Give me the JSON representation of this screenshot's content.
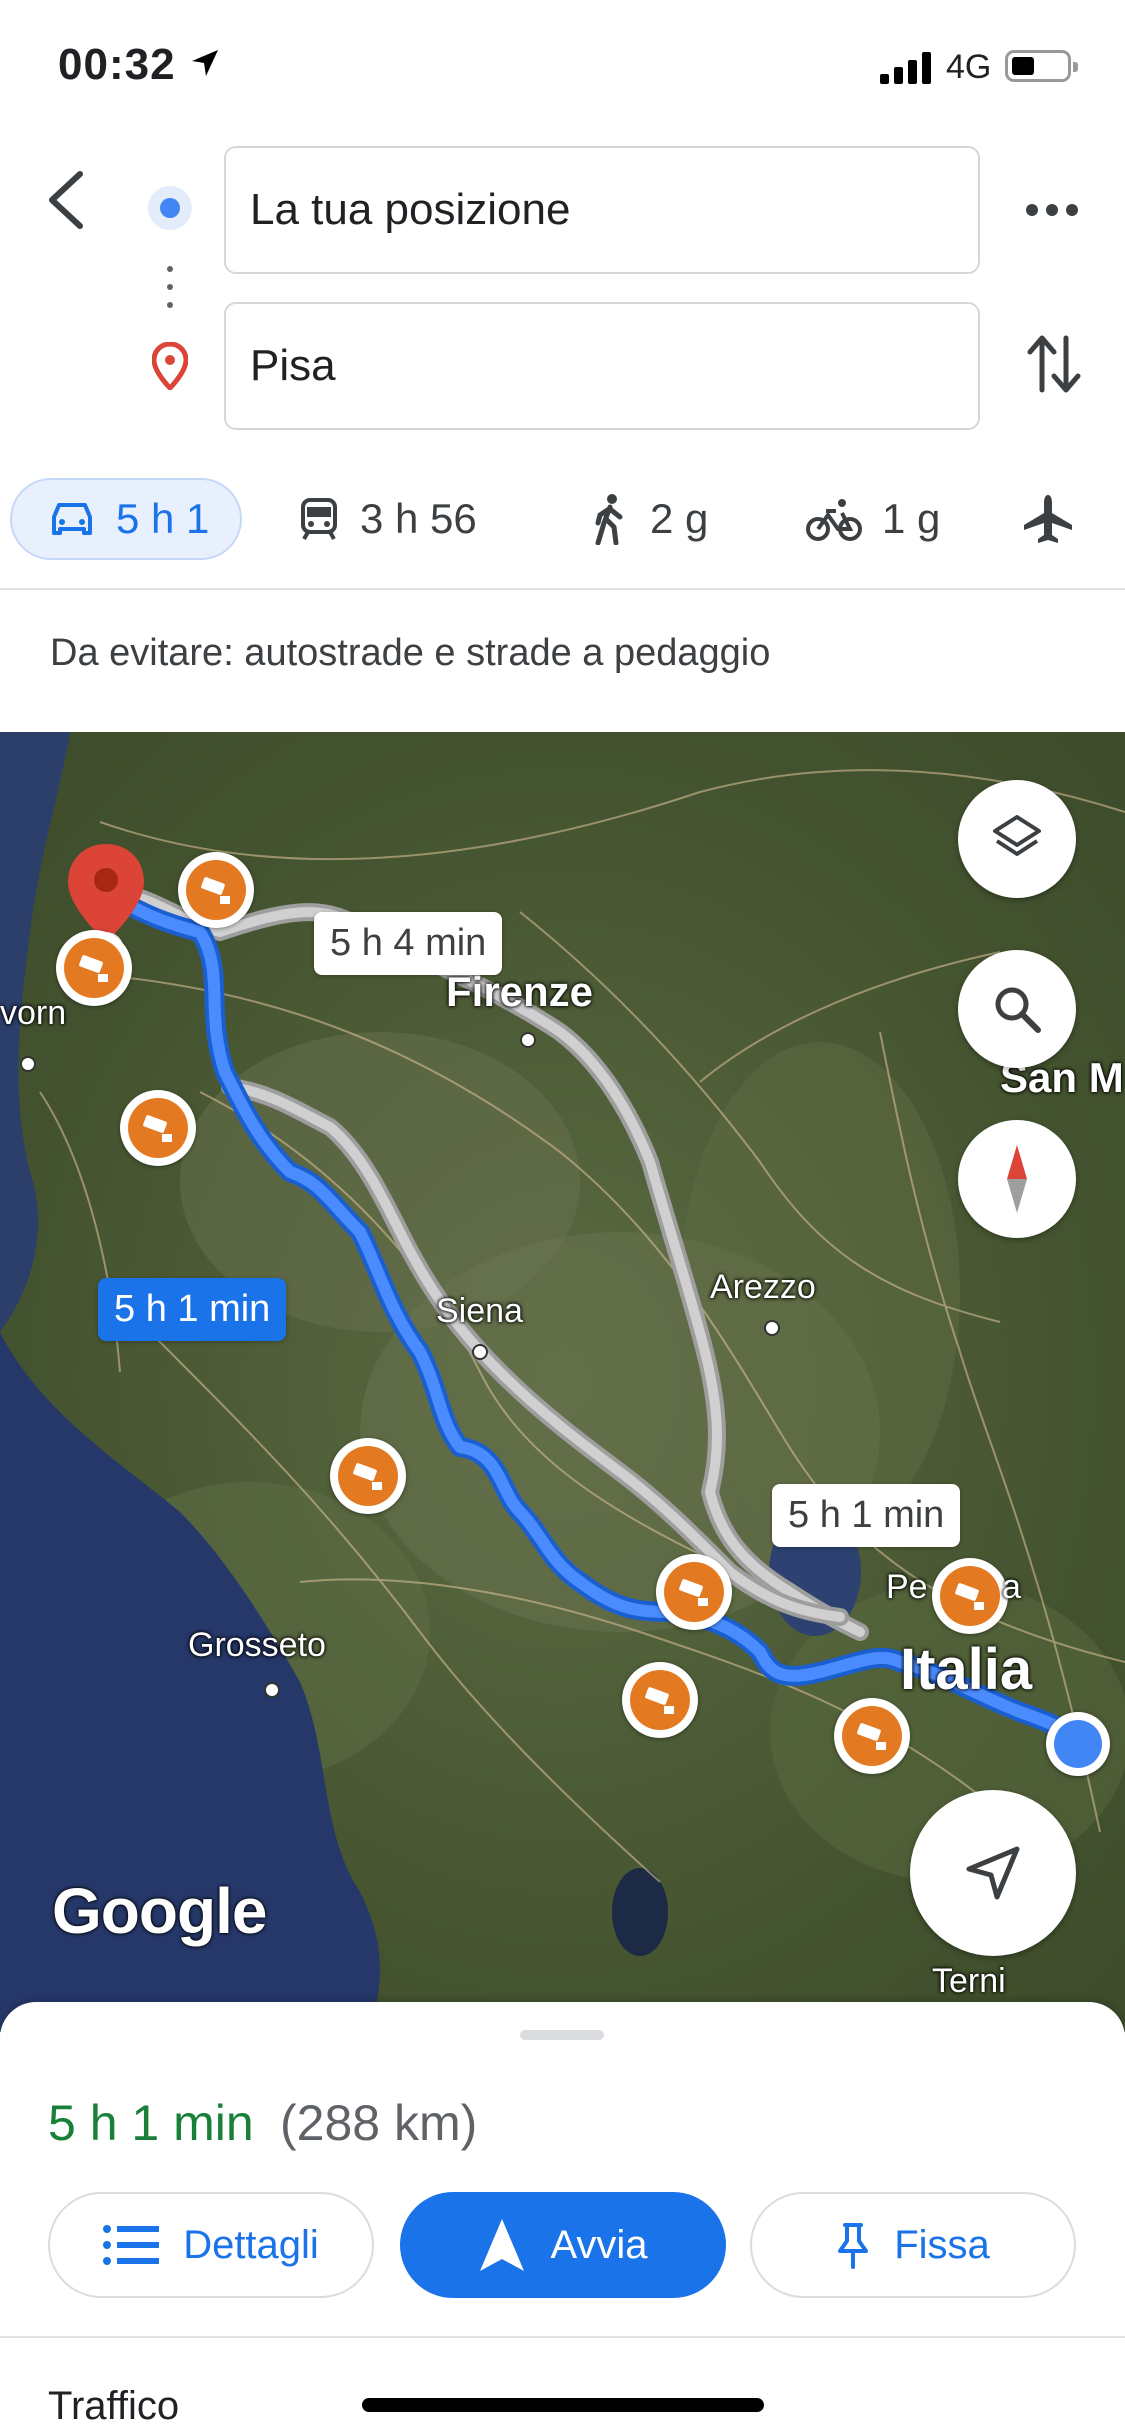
{
  "status_bar": {
    "time": "00:32",
    "network": "4G",
    "icons": [
      "location-arrow-icon",
      "signal-icon",
      "battery-icon"
    ]
  },
  "search": {
    "origin": "La tua posizione",
    "destination": "Pisa",
    "icons": [
      "back-arrow-icon",
      "origin-dot-icon",
      "destination-pin-icon",
      "more-icon",
      "swap-icon"
    ]
  },
  "modes": [
    {
      "name": "car",
      "label": "5 h 1",
      "selected": true
    },
    {
      "name": "transit",
      "label": "3 h 56"
    },
    {
      "name": "walk",
      "label": "2 g"
    },
    {
      "name": "bike",
      "label": "1 g"
    },
    {
      "name": "plane",
      "label": ""
    }
  ],
  "avoid_text": "Da evitare: autostrade e strade a pedaggio",
  "map": {
    "route_labels": {
      "main": "5 h 1 min",
      "alt1": "5 h 4 min",
      "alt2": "5 h 1 min"
    },
    "places": {
      "firenze": "Firenze",
      "livorno": "vorn",
      "san": "San M",
      "arezzo": "Arezzo",
      "siena": "Siena",
      "grosseto": "Grosseto",
      "italia": "Italia",
      "perugia": "Pe",
      "perugia2": "a",
      "terni": "Terni"
    },
    "logo": "Google",
    "colors": {
      "route": "#4285f4",
      "alt_route": "#bdbdbd",
      "pin": "#db4437",
      "camera": "#e37a21"
    }
  },
  "sheet": {
    "time": "5 h 1 min",
    "distance": "(288 km)",
    "buttons": {
      "details": "Dettagli",
      "start": "Avvia",
      "pin": "Fissa"
    },
    "traffic": "Traffico"
  }
}
